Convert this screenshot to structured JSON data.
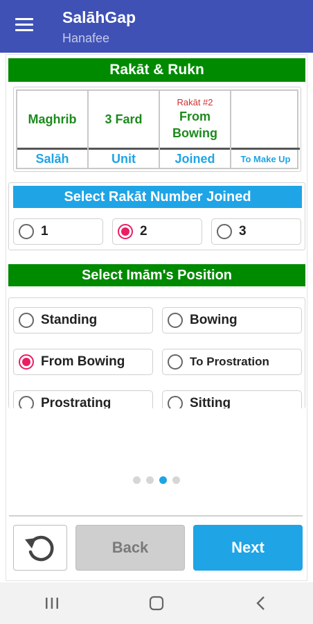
{
  "appbar": {
    "title": "SalāhGap",
    "subtitle": "Hanafee",
    "menu_icon": "hamburger-menu-icon"
  },
  "header": {
    "title": "Rakāt & Rukn"
  },
  "summary": {
    "cells": [
      {
        "value": "Maghrib",
        "label": "Salāh"
      },
      {
        "value": "3 Fard",
        "label": "Unit"
      },
      {
        "rakat_tag": "Rakāt #2",
        "value": "From Bowing",
        "label": "Joined"
      },
      {
        "value": "",
        "label": "To Make Up"
      }
    ]
  },
  "rakat_select": {
    "title": "Select Rakāt Number Joined",
    "options": [
      "1",
      "2",
      "3"
    ],
    "selected": "2"
  },
  "imam_position": {
    "title": "Select Imām's Position",
    "options": [
      "Standing",
      "Bowing",
      "From Bowing",
      "To Prostration",
      "Prostrating",
      "Sitting"
    ],
    "selected": "From Bowing"
  },
  "pager": {
    "page_count": 4,
    "current_page": 3
  },
  "footer": {
    "restart_icon": "restart-icon",
    "back_label": "Back",
    "next_label": "Next"
  },
  "system_nav": {
    "recents_icon": "recents-icon",
    "home_icon": "home-icon",
    "back_icon": "back-nav-icon"
  },
  "colors": {
    "appbar": "#3f51b5",
    "green": "#008a00",
    "blue": "#1fa4e6",
    "radio_checked": "#e91e63",
    "rakat_tag": "#d32f2f"
  }
}
